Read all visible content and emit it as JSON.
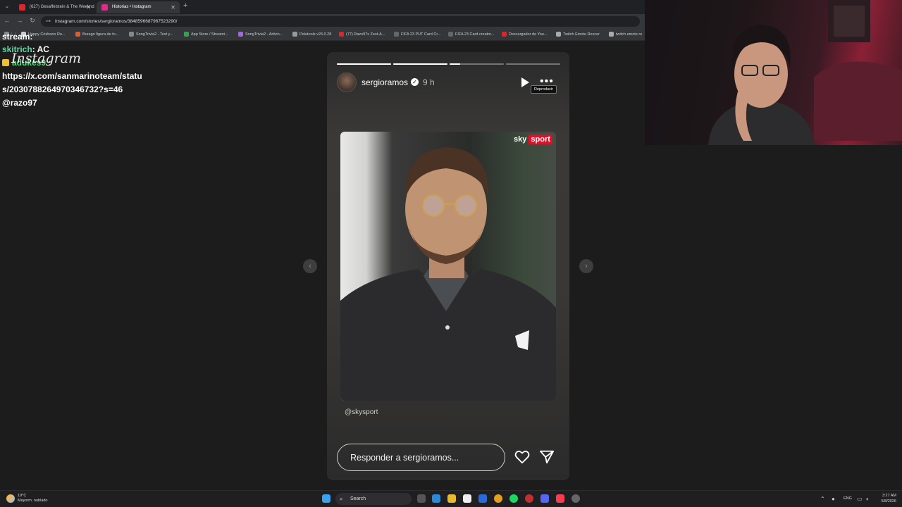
{
  "browser": {
    "tabs": [
      {
        "label": "(627) Gesaffelstein & The Weeknd",
        "color": "#e0242a"
      },
      {
        "label": "Historias • Instagram",
        "color": "#d6308a"
      }
    ],
    "url": "instagram.com/stories/sergioramos/3848596687967523290/",
    "bookmarks": [
      {
        "label": "Happy Crisbano Ro...",
        "color": "#cccccc"
      },
      {
        "label": "Burago figura de to...",
        "color": "#e05a2a"
      },
      {
        "label": "SongTrivia2 - Test y...",
        "color": "#888888"
      },
      {
        "label": "App Store / Streami...",
        "color": "#2aa84a"
      },
      {
        "label": "SongTrivia2 - Adivin...",
        "color": "#9b6bd8"
      },
      {
        "label": "Peletools v26.0.28",
        "color": "#999999"
      },
      {
        "label": "(77) Razo97s Zest-A...",
        "color": "#e0242a"
      },
      {
        "label": "FIFA 23 PUT Card Cr...",
        "color": "#666666"
      },
      {
        "label": "FIFA 23 Card creator...",
        "color": "#666666"
      },
      {
        "label": "Descargador de You...",
        "color": "#e0242a"
      },
      {
        "label": "Twitch Emote Rescer",
        "color": "#aaaaaa"
      },
      {
        "label": "twitch emote re",
        "color": "#aaaaaa"
      }
    ]
  },
  "chat": {
    "partial_line": "stream:",
    "user1": "skitrich",
    "user1_text": ": AC",
    "user2": "adukes9",
    "user2_sep": ":",
    "message_line1": "https://x.com/sanmarinoteam/statu",
    "message_line2": "s/2030788264970346732?s=46",
    "message_line3": "@razo97",
    "logo_text": "Instagram"
  },
  "story": {
    "username": "sergioramos",
    "time": "9 h",
    "tooltip": "Reproducir",
    "photo_brand_a": "sky",
    "photo_brand_b": "sport",
    "caption": "@skysport",
    "reply_placeholder": "Responder a sergioramos...",
    "progress": [
      1,
      1,
      0.2,
      0,
      0
    ]
  },
  "taskbar": {
    "weather_temp": "19°C",
    "weather_desc": "Mayorm. nublado",
    "search": "Search",
    "lang": "ENG",
    "time": "3:27 AM",
    "date": "5/8/2026"
  }
}
